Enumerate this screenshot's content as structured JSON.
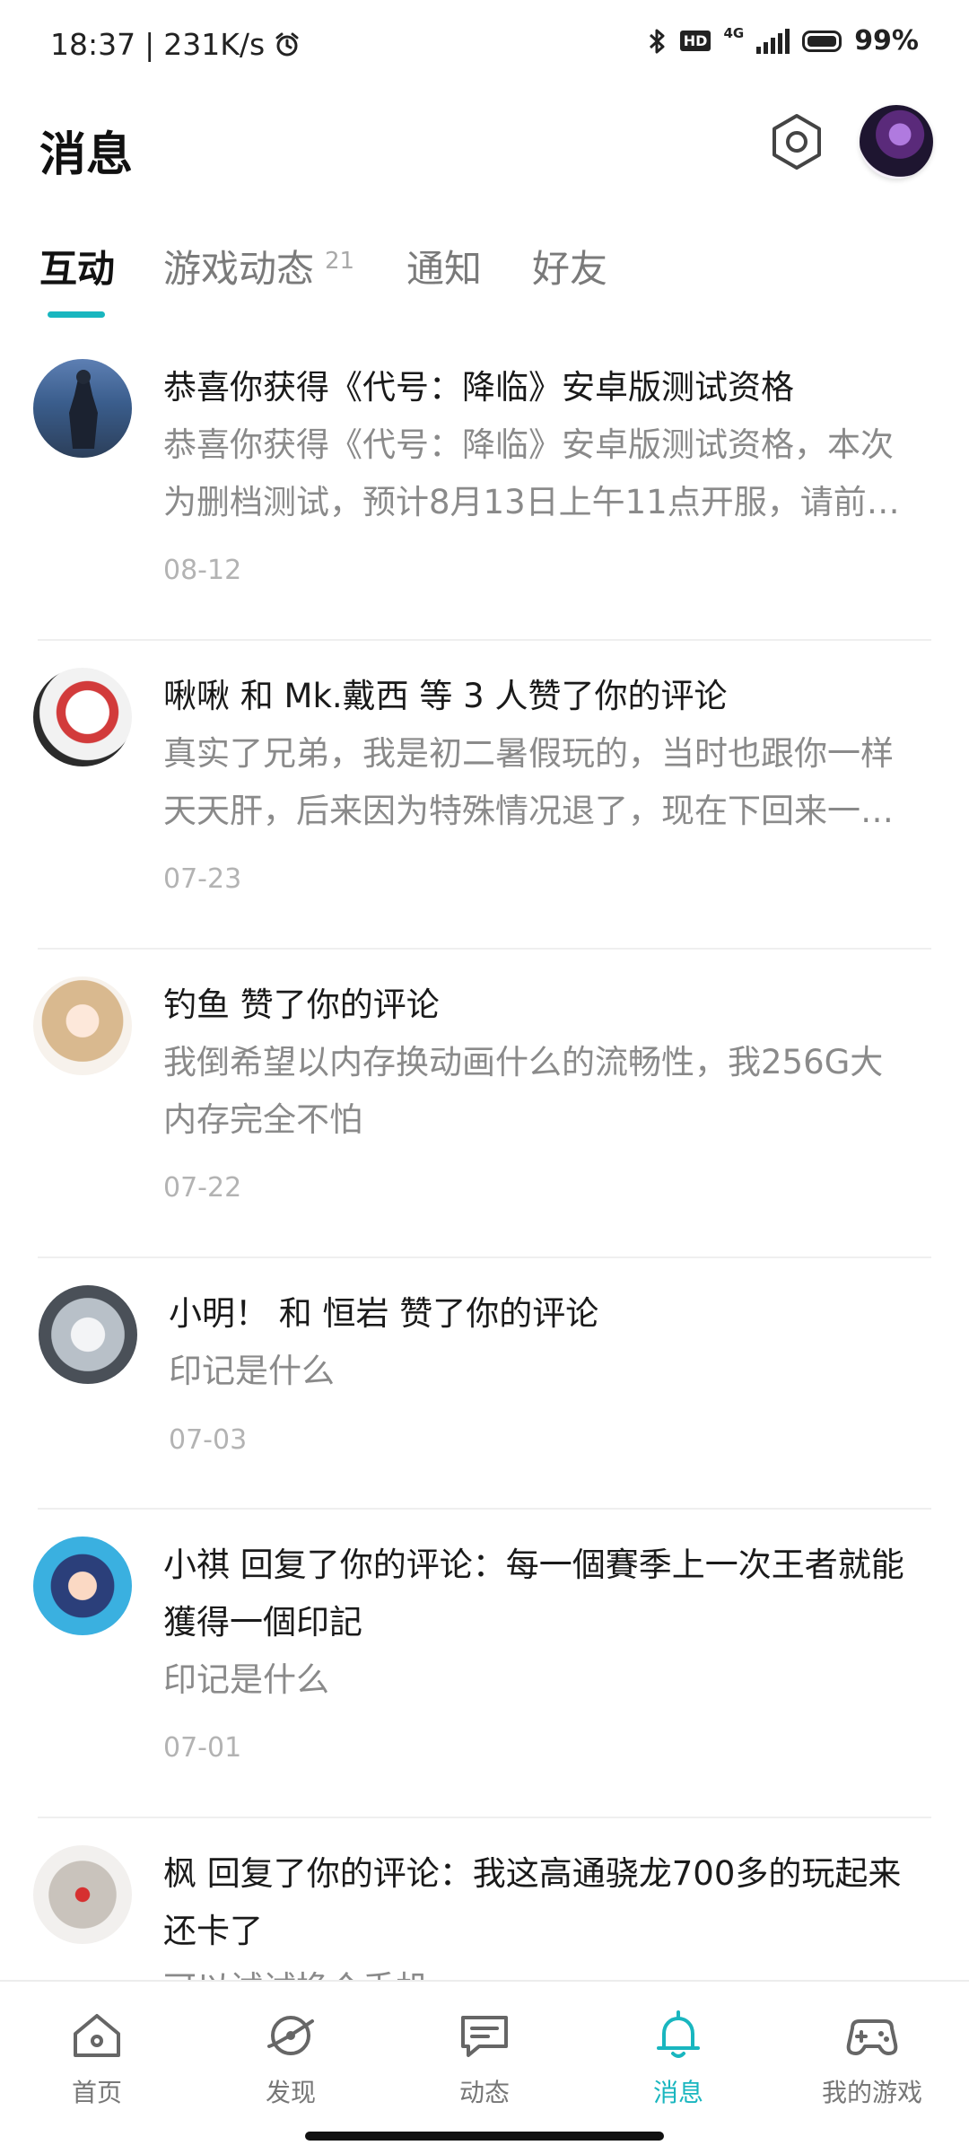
{
  "status_bar": {
    "time": "18:37",
    "net_speed": "231K/s",
    "network": "4G",
    "battery": "99%"
  },
  "header": {
    "title": "消息"
  },
  "tabs": [
    {
      "label": "互动",
      "active": true
    },
    {
      "label": "游戏动态",
      "badge": "21",
      "active": false
    },
    {
      "label": "通知",
      "active": false
    },
    {
      "label": "好友",
      "active": false
    }
  ],
  "messages": [
    {
      "title": "恭喜你获得《代号：降临》安卓版测试资格",
      "body_lines": [
        "恭喜你获得《代号：降临》安卓版测试资格，本次",
        "为删档测试，预计8月13日上午11点开服，请前…"
      ],
      "date": "08-12"
    },
    {
      "title": "啾啾 和 Mk.戴西 等 3 人赞了你的评论",
      "body_lines": [
        "真实了兄弟，我是初二暑假玩的，当时也跟你一样",
        "天天肝，后来因为特殊情况退了，现在下回来一…"
      ],
      "date": "07-23"
    },
    {
      "title": "钓鱼 赞了你的评论",
      "body_lines": [
        "我倒希望以内存换动画什么的流畅性，我256G大",
        "内存完全不怕"
      ],
      "date": "07-22"
    },
    {
      "title": "小明！ 和 恒岩 赞了你的评论",
      "body_lines": [
        "印记是什么"
      ],
      "date": "07-03"
    },
    {
      "title": "小祺 回复了你的评论：每一個賽季上一次王者就能获得一個印記",
      "title_lines": [
        "小祺 回复了你的评论：每一個賽季上一次王者就能",
        "獲得一個印記"
      ],
      "body_lines": [
        "印记是什么"
      ],
      "date": "07-01"
    },
    {
      "title_lines": [
        "枫 回复了你的评论：我这高通骁龙700多的玩起来",
        "还卡了"
      ],
      "body_lines": [
        "可以试试换个手机"
      ],
      "date": ""
    }
  ],
  "bottom_nav": [
    {
      "label": "首页",
      "icon": "home-icon",
      "active": false
    },
    {
      "label": "发现",
      "icon": "compass-icon",
      "active": false
    },
    {
      "label": "动态",
      "icon": "chat-icon",
      "active": false
    },
    {
      "label": "消息",
      "icon": "bell-icon",
      "active": true
    },
    {
      "label": "我的游戏",
      "icon": "gamepad-icon",
      "active": false
    }
  ],
  "colors": {
    "accent": "#19b6bf",
    "text_primary": "#1a1a1a",
    "text_secondary": "#8a8a8a",
    "text_muted": "#b3b3b3"
  }
}
